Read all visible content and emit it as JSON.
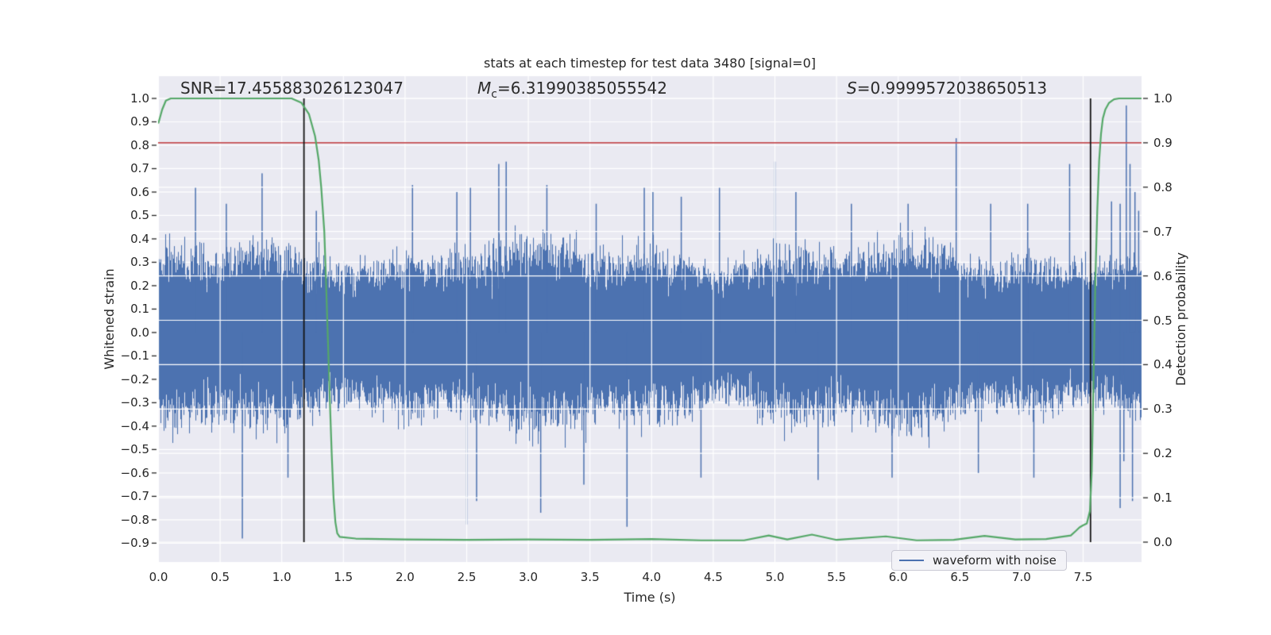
{
  "figure": {
    "background": "#ffffff"
  },
  "chart_data": {
    "type": "line",
    "title": "stats at each timestep for test data 3480 [signal=0]",
    "xlabel": "Time (s)",
    "ylabel_left": "Whitened strain",
    "ylabel_right": "Detection probability",
    "background_color": "#EAEAF2",
    "grid_color": "#FFFFFF",
    "text_color": "#262626",
    "grid": true,
    "x_ticks": [
      0.0,
      0.5,
      1.0,
      1.5,
      2.0,
      2.5,
      3.0,
      3.5,
      4.0,
      4.5,
      5.0,
      5.5,
      6.0,
      6.5,
      7.0,
      7.5
    ],
    "y_ticks_left": [
      1.0,
      0.9,
      0.8,
      0.7,
      0.6,
      0.5,
      0.4,
      0.3,
      0.2,
      0.1,
      0.0,
      -0.1,
      -0.2,
      -0.3,
      -0.4,
      -0.5,
      -0.6,
      -0.7,
      -0.8,
      -0.9
    ],
    "y_ticks_right": [
      1.0,
      0.9,
      0.8,
      0.7,
      0.6,
      0.5,
      0.4,
      0.3,
      0.2,
      0.1,
      0.0
    ],
    "xlim": [
      0.0,
      7.97
    ],
    "ylim_left": [
      -0.98,
      1.09
    ],
    "ylim_right": [
      -0.045,
      1.05
    ],
    "annotations": [
      {
        "id": "snr",
        "text": "SNR=17.455883026123047"
      },
      {
        "id": "chirp-mass",
        "symbol": "M",
        "subscript": "c",
        "value": "=6.31990385055542"
      },
      {
        "id": "significance",
        "symbol": "S",
        "value": "=0.9999572038650513"
      }
    ],
    "threshold": {
      "axis": "right",
      "value": 0.9,
      "color": "#C44E52"
    },
    "vlines": {
      "color": "#141414",
      "times": [
        1.18,
        7.56
      ],
      "span_right_axis": [
        0.0,
        1.0
      ]
    },
    "legend": {
      "label": "waveform with noise",
      "color": "#4C72B0"
    },
    "series": [
      {
        "name": "waveform with noise",
        "kind": "noise-envelope",
        "axis": "left",
        "color": "#4C72B0",
        "noise": {
          "seed": 20480,
          "pos_mean": 0.285,
          "pos_std": 0.095,
          "neg_mean": 0.305,
          "neg_std": 0.1,
          "min_amp": 0.135,
          "max_amp": 0.62
        },
        "spikes_up": [
          [
            0.3,
            0.62
          ],
          [
            0.55,
            0.55
          ],
          [
            0.84,
            0.68
          ],
          [
            1.28,
            0.52
          ],
          [
            2.06,
            0.63
          ],
          [
            2.42,
            0.6
          ],
          [
            2.53,
            0.62
          ],
          [
            2.76,
            0.72
          ],
          [
            2.82,
            0.73
          ],
          [
            3.15,
            0.63
          ],
          [
            3.55,
            0.55
          ],
          [
            3.94,
            0.62
          ],
          [
            4.01,
            0.6
          ],
          [
            4.24,
            0.58
          ],
          [
            4.55,
            0.62
          ],
          [
            5.0,
            0.73
          ],
          [
            5.17,
            0.6
          ],
          [
            5.62,
            0.55
          ],
          [
            6.08,
            0.55
          ],
          [
            6.47,
            0.83
          ],
          [
            6.75,
            0.55
          ],
          [
            7.05,
            0.55
          ],
          [
            7.39,
            0.72
          ],
          [
            7.73,
            0.56
          ],
          [
            7.8,
            0.55
          ],
          [
            7.85,
            0.97
          ],
          [
            7.88,
            0.72
          ],
          [
            7.92,
            0.6
          ],
          [
            7.95,
            0.52
          ]
        ],
        "spikes_down": [
          [
            0.68,
            -0.88
          ],
          [
            1.05,
            -0.62
          ],
          [
            2.5,
            -0.82
          ],
          [
            2.58,
            -0.72
          ],
          [
            3.1,
            -0.77
          ],
          [
            3.45,
            -0.65
          ],
          [
            3.8,
            -0.83
          ],
          [
            4.4,
            -0.62
          ],
          [
            5.35,
            -0.63
          ],
          [
            5.95,
            -0.62
          ],
          [
            6.65,
            -0.6
          ],
          [
            7.1,
            -0.62
          ],
          [
            7.8,
            -0.75
          ],
          [
            7.83,
            -0.55
          ],
          [
            7.9,
            -0.72
          ]
        ]
      },
      {
        "name": "detection probability",
        "kind": "line",
        "axis": "right",
        "color": "#55A868",
        "points": [
          [
            0.0,
            0.945
          ],
          [
            0.03,
            0.975
          ],
          [
            0.06,
            0.995
          ],
          [
            0.1,
            1.0
          ],
          [
            1.08,
            1.0
          ],
          [
            1.16,
            0.99
          ],
          [
            1.22,
            0.965
          ],
          [
            1.27,
            0.915
          ],
          [
            1.3,
            0.86
          ],
          [
            1.32,
            0.8
          ],
          [
            1.345,
            0.7
          ],
          [
            1.36,
            0.58
          ],
          [
            1.375,
            0.45
          ],
          [
            1.39,
            0.32
          ],
          [
            1.405,
            0.2
          ],
          [
            1.42,
            0.1
          ],
          [
            1.435,
            0.045
          ],
          [
            1.45,
            0.02
          ],
          [
            1.47,
            0.012
          ],
          [
            1.6,
            0.008
          ],
          [
            2.0,
            0.006
          ],
          [
            2.5,
            0.005
          ],
          [
            3.0,
            0.006
          ],
          [
            3.5,
            0.005
          ],
          [
            4.0,
            0.007
          ],
          [
            4.4,
            0.004
          ],
          [
            4.75,
            0.004
          ],
          [
            4.95,
            0.015
          ],
          [
            5.1,
            0.006
          ],
          [
            5.3,
            0.017
          ],
          [
            5.5,
            0.005
          ],
          [
            5.9,
            0.013
          ],
          [
            6.15,
            0.004
          ],
          [
            6.45,
            0.005
          ],
          [
            6.7,
            0.014
          ],
          [
            6.95,
            0.006
          ],
          [
            7.2,
            0.007
          ],
          [
            7.32,
            0.012
          ],
          [
            7.4,
            0.015
          ],
          [
            7.44,
            0.025
          ],
          [
            7.47,
            0.033
          ],
          [
            7.5,
            0.038
          ],
          [
            7.53,
            0.042
          ],
          [
            7.555,
            0.07
          ],
          [
            7.57,
            0.16
          ],
          [
            7.58,
            0.3
          ],
          [
            7.59,
            0.45
          ],
          [
            7.6,
            0.6
          ],
          [
            7.615,
            0.75
          ],
          [
            7.63,
            0.86
          ],
          [
            7.645,
            0.92
          ],
          [
            7.66,
            0.955
          ],
          [
            7.68,
            0.975
          ],
          [
            7.71,
            0.99
          ],
          [
            7.75,
            0.998
          ],
          [
            7.79,
            1.0
          ],
          [
            7.97,
            1.0
          ]
        ]
      }
    ]
  }
}
